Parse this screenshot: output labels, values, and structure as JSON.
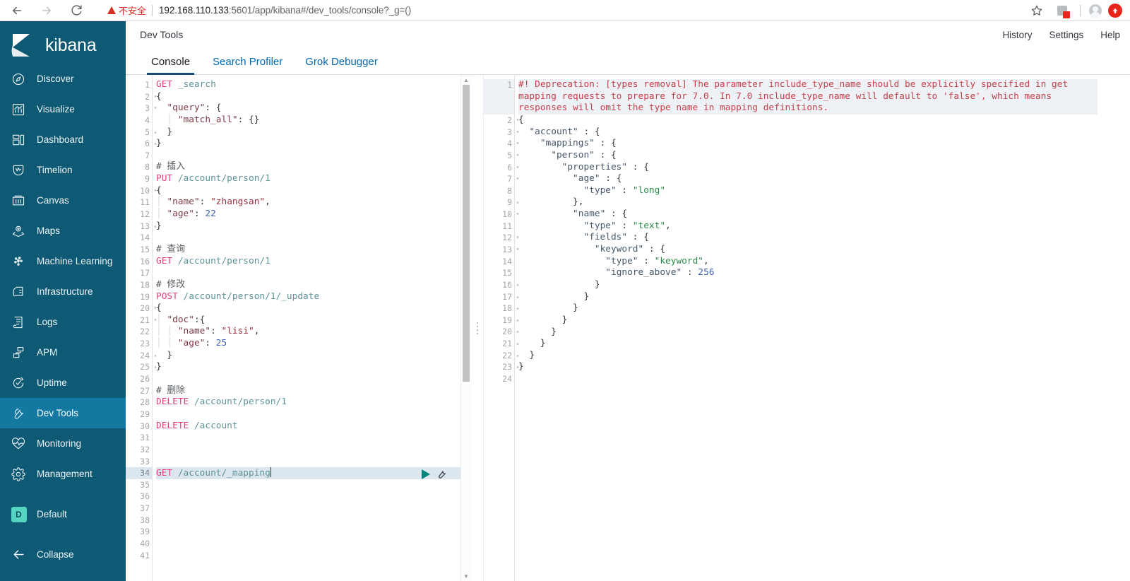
{
  "browser": {
    "back_icon": "back-arrow-icon",
    "forward_icon": "forward-arrow-icon",
    "reload_icon": "reload-icon",
    "security_label": "不安全",
    "url_host": "192.168.110.133",
    "url_rest": ":5601/app/kibana#/dev_tools/console?_g=()",
    "bookmark_icon": "star-icon",
    "extensions_icon": "puzzle-icon",
    "profile_icon": "avatar-icon",
    "app_icon": "red-badge-icon"
  },
  "sidebar": {
    "brand": "kibana",
    "items": [
      {
        "label": "Discover",
        "icon": "compass-icon",
        "active": false
      },
      {
        "label": "Visualize",
        "icon": "bar-chart-icon",
        "active": false
      },
      {
        "label": "Dashboard",
        "icon": "dashboard-icon",
        "active": false
      },
      {
        "label": "Timelion",
        "icon": "timelion-icon",
        "active": false
      },
      {
        "label": "Canvas",
        "icon": "canvas-icon",
        "active": false
      },
      {
        "label": "Maps",
        "icon": "map-marker-icon",
        "active": false
      },
      {
        "label": "Machine Learning",
        "icon": "machine-learning-icon",
        "active": false
      },
      {
        "label": "Infrastructure",
        "icon": "infrastructure-icon",
        "active": false
      },
      {
        "label": "Logs",
        "icon": "logs-icon",
        "active": false
      },
      {
        "label": "APM",
        "icon": "apm-icon",
        "active": false
      },
      {
        "label": "Uptime",
        "icon": "uptime-icon",
        "active": false
      },
      {
        "label": "Dev Tools",
        "icon": "wrench-icon",
        "active": true
      },
      {
        "label": "Monitoring",
        "icon": "heartbeat-icon",
        "active": false
      },
      {
        "label": "Management",
        "icon": "gear-icon",
        "active": false
      }
    ],
    "space": {
      "badge": "D",
      "label": "Default"
    },
    "collapse": {
      "label": "Collapse",
      "icon": "arrow-left-icon"
    }
  },
  "header": {
    "title": "Dev Tools",
    "links": [
      "History",
      "Settings",
      "Help"
    ]
  },
  "tabs": [
    {
      "label": "Console",
      "active": true
    },
    {
      "label": "Search Profiler",
      "active": false
    },
    {
      "label": "Grok Debugger",
      "active": false
    }
  ],
  "console": {
    "run_icon": "play-icon",
    "wrench_icon": "wrench-icon",
    "splitter_icon": "drag-handle-icon",
    "editor": {
      "active_line": 34,
      "total_lines": 41,
      "lines": [
        {
          "n": 1,
          "fold": "",
          "tokens": [
            [
              "m",
              "GET"
            ],
            [
              "p",
              " "
            ],
            [
              "u",
              "_search"
            ]
          ]
        },
        {
          "n": 2,
          "fold": "▾",
          "tokens": [
            [
              "p",
              "{"
            ]
          ]
        },
        {
          "n": 3,
          "fold": "▾",
          "tokens": [
            [
              "p",
              "  "
            ],
            [
              "k",
              "\"query\""
            ],
            [
              "p",
              ": {"
            ]
          ]
        },
        {
          "n": 4,
          "fold": "",
          "tokens": [
            [
              "guide",
              "  │ "
            ],
            [
              "k",
              "\"match_all\""
            ],
            [
              "p",
              ": {}"
            ]
          ]
        },
        {
          "n": 5,
          "fold": "▴",
          "tokens": [
            [
              "p",
              "  }"
            ]
          ]
        },
        {
          "n": 6,
          "fold": "▴",
          "tokens": [
            [
              "p",
              "}"
            ]
          ]
        },
        {
          "n": 7,
          "fold": "",
          "tokens": []
        },
        {
          "n": 8,
          "fold": "",
          "tokens": [
            [
              "cm",
              "# 插入"
            ]
          ]
        },
        {
          "n": 9,
          "fold": "",
          "tokens": [
            [
              "m",
              "PUT"
            ],
            [
              "p",
              " "
            ],
            [
              "u",
              "/account/person/1"
            ]
          ]
        },
        {
          "n": 10,
          "fold": "▾",
          "tokens": [
            [
              "p",
              "{"
            ]
          ]
        },
        {
          "n": 11,
          "fold": "",
          "tokens": [
            [
              "guide",
              "│ "
            ],
            [
              "k",
              "\"name\""
            ],
            [
              "p",
              ": "
            ],
            [
              "s",
              "\"zhangsan\""
            ],
            [
              "p",
              ","
            ]
          ]
        },
        {
          "n": 12,
          "fold": "",
          "tokens": [
            [
              "guide",
              "│ "
            ],
            [
              "k",
              "\"age\""
            ],
            [
              "p",
              ": "
            ],
            [
              "n",
              "22"
            ]
          ]
        },
        {
          "n": 13,
          "fold": "▴",
          "tokens": [
            [
              "p",
              "}"
            ]
          ]
        },
        {
          "n": 14,
          "fold": "",
          "tokens": []
        },
        {
          "n": 15,
          "fold": "",
          "tokens": [
            [
              "cm",
              "# 查询"
            ]
          ]
        },
        {
          "n": 16,
          "fold": "",
          "tokens": [
            [
              "m",
              "GET"
            ],
            [
              "p",
              " "
            ],
            [
              "u",
              "/account/person/1"
            ]
          ]
        },
        {
          "n": 17,
          "fold": "",
          "tokens": []
        },
        {
          "n": 18,
          "fold": "",
          "tokens": [
            [
              "cm",
              "# 修改"
            ]
          ]
        },
        {
          "n": 19,
          "fold": "",
          "tokens": [
            [
              "m",
              "POST"
            ],
            [
              "p",
              " "
            ],
            [
              "u",
              "/account/person/1/_update"
            ]
          ]
        },
        {
          "n": 20,
          "fold": "▾",
          "tokens": [
            [
              "p",
              "{"
            ]
          ]
        },
        {
          "n": 21,
          "fold": "▾",
          "tokens": [
            [
              "guide",
              "│ "
            ],
            [
              "k",
              "\"doc\""
            ],
            [
              "p",
              ":{"
            ]
          ]
        },
        {
          "n": 22,
          "fold": "",
          "tokens": [
            [
              "guide",
              "│ │ "
            ],
            [
              "k",
              "\"name\""
            ],
            [
              "p",
              ": "
            ],
            [
              "s",
              "\"lisi\""
            ],
            [
              "p",
              ","
            ]
          ]
        },
        {
          "n": 23,
          "fold": "",
          "tokens": [
            [
              "guide",
              "│ │ "
            ],
            [
              "k",
              "\"age\""
            ],
            [
              "p",
              ": "
            ],
            [
              "n",
              "25"
            ]
          ]
        },
        {
          "n": 24,
          "fold": "▴",
          "tokens": [
            [
              "p",
              "  }"
            ]
          ]
        },
        {
          "n": 25,
          "fold": "▴",
          "tokens": [
            [
              "p",
              "}"
            ]
          ]
        },
        {
          "n": 26,
          "fold": "",
          "tokens": []
        },
        {
          "n": 27,
          "fold": "",
          "tokens": [
            [
              "cm",
              "# 删除"
            ]
          ]
        },
        {
          "n": 28,
          "fold": "",
          "tokens": [
            [
              "m",
              "DELETE"
            ],
            [
              "p",
              " "
            ],
            [
              "u",
              "/account/person/1"
            ]
          ]
        },
        {
          "n": 29,
          "fold": "",
          "tokens": []
        },
        {
          "n": 30,
          "fold": "",
          "tokens": [
            [
              "m",
              "DELETE"
            ],
            [
              "p",
              " "
            ],
            [
              "u",
              "/account"
            ]
          ]
        },
        {
          "n": 31,
          "fold": "",
          "tokens": []
        },
        {
          "n": 32,
          "fold": "",
          "tokens": []
        },
        {
          "n": 33,
          "fold": "",
          "tokens": []
        },
        {
          "n": 34,
          "fold": "",
          "tokens": [
            [
              "m",
              "GET"
            ],
            [
              "p",
              " "
            ],
            [
              "u",
              "/account/_mapping"
            ],
            [
              "cursor",
              ""
            ]
          ]
        },
        {
          "n": 35,
          "fold": "",
          "tokens": []
        },
        {
          "n": 36,
          "fold": "",
          "tokens": []
        },
        {
          "n": 37,
          "fold": "",
          "tokens": []
        },
        {
          "n": 38,
          "fold": "",
          "tokens": []
        },
        {
          "n": 39,
          "fold": "",
          "tokens": []
        },
        {
          "n": 40,
          "fold": "",
          "tokens": []
        },
        {
          "n": 41,
          "fold": "",
          "tokens": []
        }
      ]
    },
    "output": {
      "total_lines": 24,
      "deprecation": "#! Deprecation: [types removal] The parameter include_type_name should be explicitly specified in get mapping requests to prepare for 7.0. In 7.0 include_type_name will default to 'false', which means responses will omit the type name in mapping definitions.",
      "lines": [
        {
          "n": 2,
          "fold": "▾",
          "tokens": [
            [
              "op",
              "{"
            ]
          ]
        },
        {
          "n": 3,
          "fold": "▾",
          "tokens": [
            [
              "op",
              "  "
            ],
            [
              "ok",
              "\"account\""
            ],
            [
              "op",
              " : {"
            ]
          ]
        },
        {
          "n": 4,
          "fold": "▾",
          "tokens": [
            [
              "op",
              "    "
            ],
            [
              "ok",
              "\"mappings\""
            ],
            [
              "op",
              " : {"
            ]
          ]
        },
        {
          "n": 5,
          "fold": "▾",
          "tokens": [
            [
              "op",
              "      "
            ],
            [
              "ok",
              "\"person\""
            ],
            [
              "op",
              " : {"
            ]
          ]
        },
        {
          "n": 6,
          "fold": "▾",
          "tokens": [
            [
              "op",
              "        "
            ],
            [
              "ok",
              "\"properties\""
            ],
            [
              "op",
              " : {"
            ]
          ]
        },
        {
          "n": 7,
          "fold": "▾",
          "tokens": [
            [
              "op",
              "          "
            ],
            [
              "ok",
              "\"age\""
            ],
            [
              "op",
              " : {"
            ]
          ]
        },
        {
          "n": 8,
          "fold": "",
          "tokens": [
            [
              "op",
              "            "
            ],
            [
              "ok",
              "\"type\""
            ],
            [
              "op",
              " : "
            ],
            [
              "os",
              "\"long\""
            ]
          ]
        },
        {
          "n": 9,
          "fold": "▴",
          "tokens": [
            [
              "op",
              "          },"
            ]
          ]
        },
        {
          "n": 10,
          "fold": "▾",
          "tokens": [
            [
              "op",
              "          "
            ],
            [
              "ok",
              "\"name\""
            ],
            [
              "op",
              " : {"
            ]
          ]
        },
        {
          "n": 11,
          "fold": "",
          "tokens": [
            [
              "op",
              "            "
            ],
            [
              "ok",
              "\"type\""
            ],
            [
              "op",
              " : "
            ],
            [
              "os",
              "\"text\""
            ],
            [
              "op",
              ","
            ]
          ]
        },
        {
          "n": 12,
          "fold": "▾",
          "tokens": [
            [
              "op",
              "            "
            ],
            [
              "ok",
              "\"fields\""
            ],
            [
              "op",
              " : {"
            ]
          ]
        },
        {
          "n": 13,
          "fold": "▾",
          "tokens": [
            [
              "op",
              "              "
            ],
            [
              "ok",
              "\"keyword\""
            ],
            [
              "op",
              " : {"
            ]
          ]
        },
        {
          "n": 14,
          "fold": "",
          "tokens": [
            [
              "op",
              "                "
            ],
            [
              "ok",
              "\"type\""
            ],
            [
              "op",
              " : "
            ],
            [
              "os",
              "\"keyword\""
            ],
            [
              "op",
              ","
            ]
          ]
        },
        {
          "n": 15,
          "fold": "",
          "tokens": [
            [
              "op",
              "                "
            ],
            [
              "ok",
              "\"ignore_above\""
            ],
            [
              "op",
              " : "
            ],
            [
              "on",
              "256"
            ]
          ]
        },
        {
          "n": 16,
          "fold": "▴",
          "tokens": [
            [
              "op",
              "              }"
            ]
          ]
        },
        {
          "n": 17,
          "fold": "▴",
          "tokens": [
            [
              "op",
              "            }"
            ]
          ]
        },
        {
          "n": 18,
          "fold": "▴",
          "tokens": [
            [
              "op",
              "          }"
            ]
          ]
        },
        {
          "n": 19,
          "fold": "▴",
          "tokens": [
            [
              "op",
              "        }"
            ]
          ]
        },
        {
          "n": 20,
          "fold": "▴",
          "tokens": [
            [
              "op",
              "      }"
            ]
          ]
        },
        {
          "n": 21,
          "fold": "▴",
          "tokens": [
            [
              "op",
              "    }"
            ]
          ]
        },
        {
          "n": 22,
          "fold": "▴",
          "tokens": [
            [
              "op",
              "  }"
            ]
          ]
        },
        {
          "n": 23,
          "fold": "▴",
          "tokens": [
            [
              "op",
              "}"
            ]
          ]
        },
        {
          "n": 24,
          "fold": "",
          "tokens": []
        }
      ]
    }
  },
  "colors": {
    "sidebar_bg": "#0e5a74",
    "sidebar_active": "#1379a0",
    "accent_link": "#006bb4",
    "tab_underline": "#1b4b73",
    "play_green": "#00867d",
    "deprecation_red": "#c9404a",
    "space_badge": "#54d4c1",
    "insecure_red": "#d93025"
  }
}
